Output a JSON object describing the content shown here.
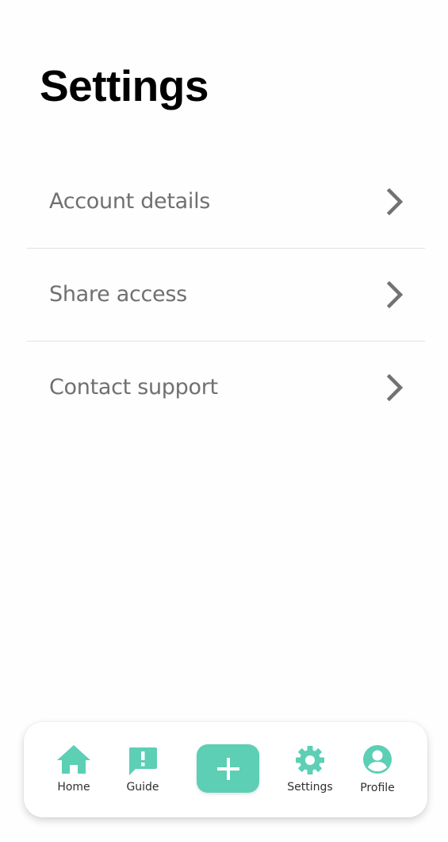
{
  "page": {
    "title": "Settings"
  },
  "settings": {
    "items": [
      {
        "label": "Account details",
        "icon": "chevron-right-icon"
      },
      {
        "label": "Share access",
        "icon": "chevron-right-icon"
      },
      {
        "label": "Contact support",
        "icon": "chevron-right-icon"
      }
    ]
  },
  "tab_bar": {
    "home": {
      "label": "Home",
      "icon": "home-icon"
    },
    "guide": {
      "label": "Guide",
      "icon": "alert-message-icon"
    },
    "add": {
      "icon": "plus-icon"
    },
    "settings": {
      "label": "Settings",
      "icon": "gear-icon"
    },
    "profile": {
      "label": "Profile",
      "icon": "account-circle-icon"
    }
  },
  "colors": {
    "accent": "#5ccfb5",
    "item_text": "#707070",
    "chevron": "#727272",
    "title": "#000000",
    "divider": "#e2e2e2"
  }
}
